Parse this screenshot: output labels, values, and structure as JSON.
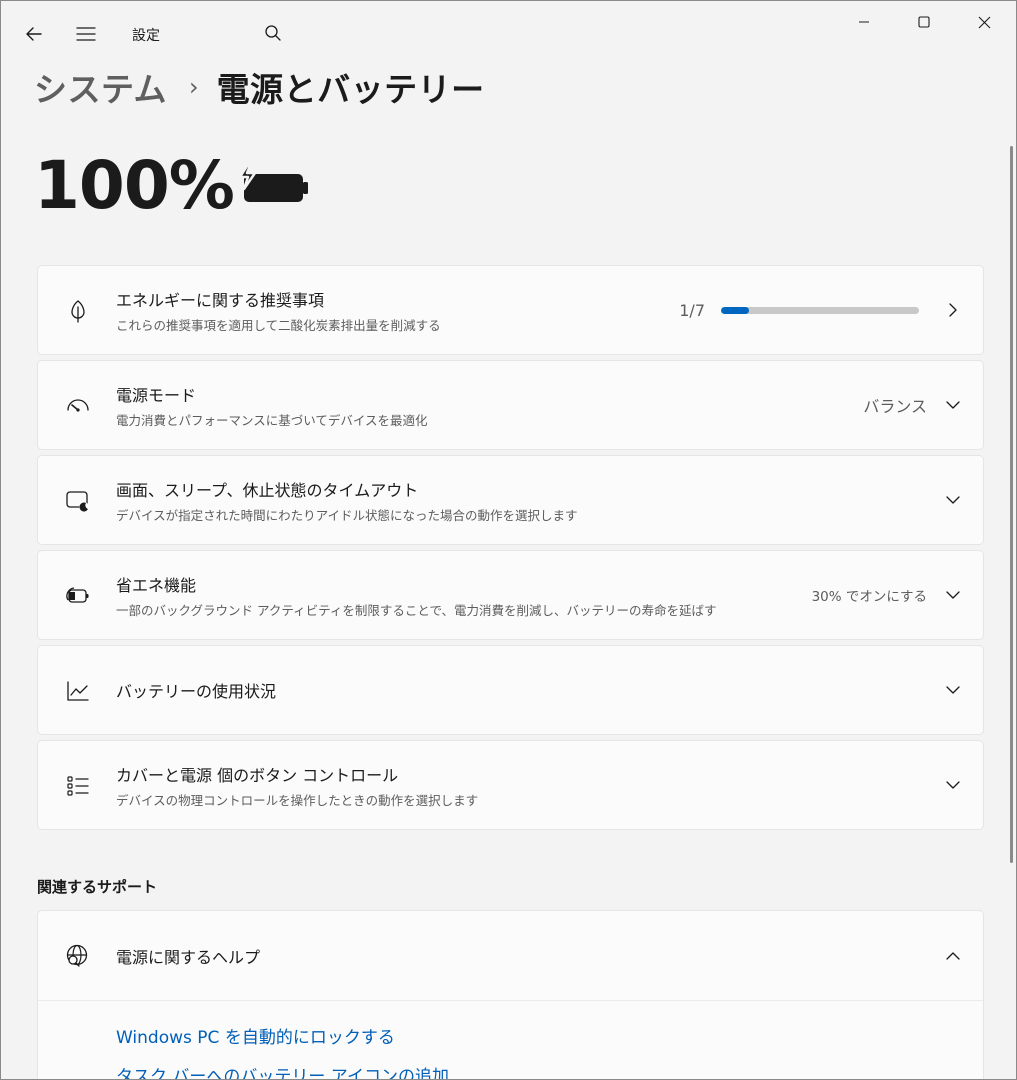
{
  "window": {
    "title": "設定"
  },
  "breadcrumb": {
    "parent": "システム",
    "separator": "›",
    "current": "電源とバッテリー"
  },
  "battery": {
    "percent_text": "100%",
    "level": 1.0,
    "charging": true
  },
  "cards": {
    "energy": {
      "title": "エネルギーに関する推奨事項",
      "subtitle": "これらの推奨事項を適用して二酸化炭素排出量を削減する",
      "progress_text": "1/7",
      "progress_fraction": 0.1428
    },
    "power_mode": {
      "title": "電源モード",
      "subtitle": "電力消費とパフォーマンスに基づいてデバイスを最適化",
      "value": "バランス"
    },
    "sleep": {
      "title": "画面、スリープ、休止状態のタイムアウト",
      "subtitle": "デバイスが指定された時間にわたりアイドル状態になった場合の動作を選択します"
    },
    "saver": {
      "title": "省エネ機能",
      "subtitle": "一部のバックグラウンド アクティビティを制限することで、電力消費を削減し、バッテリーの寿命を延ばす",
      "value": "30% でオンにする"
    },
    "usage": {
      "title": "バッテリーの使用状況"
    },
    "lid": {
      "title": "カバーと電源 個のボタン コントロール",
      "subtitle": "デバイスの物理コントロールを操作したときの動作を選択します"
    }
  },
  "support": {
    "heading": "関連するサポート",
    "help_title": "電源に関するヘルプ",
    "links": [
      "Windows PC を自動的にロックする",
      "タスク バーへのバッテリー アイコンの追加"
    ]
  },
  "colors": {
    "accent": "#0067c0",
    "link": "#005fb8",
    "background": "#f3f3f3",
    "card": "#fbfbfb"
  }
}
